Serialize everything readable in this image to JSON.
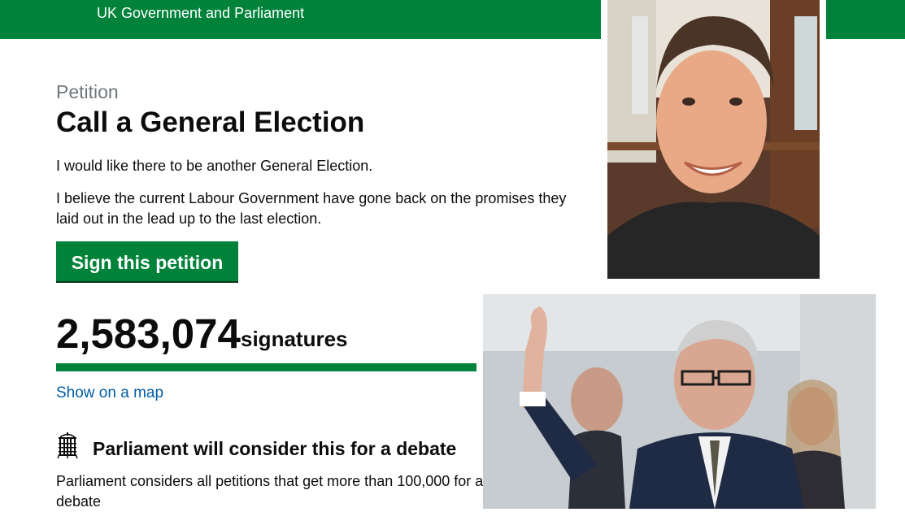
{
  "header": {
    "title": "UK Government and Parliament"
  },
  "petition": {
    "caption": "Petition",
    "title": "Call a General Election",
    "paragraphs": [
      "I would like there to be another General Election.",
      "I believe the current Labour Government have gone back on the promises they laid out in the lead up to the last election."
    ],
    "sign_label": "Sign this petition",
    "signature_count": "2,583,074",
    "signature_label": "signatures",
    "progress_fraction": 1.0,
    "map_link": "Show on a map"
  },
  "debate": {
    "heading": "Parliament will consider this for a debate",
    "text": "Parliament considers all petitions that get more than 100,000 for a debate"
  },
  "icons": {
    "parliament": "portcullis-icon"
  },
  "colors": {
    "brand_green": "#00823b",
    "link_blue": "#005ea5",
    "caption_grey": "#6f777b"
  }
}
